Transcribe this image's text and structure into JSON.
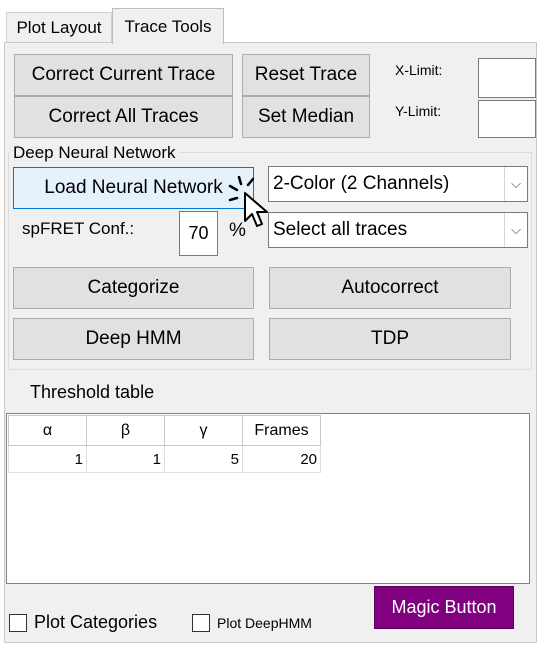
{
  "tabs": [
    {
      "label": "Plot Layout"
    },
    {
      "label": "Trace Tools"
    }
  ],
  "buttons": {
    "correct_current": "Correct Current Trace",
    "reset_trace": "Reset Trace",
    "correct_all": "Correct All Traces",
    "set_median": "Set Median",
    "load_nn": "Load Neural Network",
    "categorize": "Categorize",
    "autocorrect": "Autocorrect",
    "deep_hmm": "Deep HMM",
    "tdp": "TDP",
    "magic": "Magic Button"
  },
  "limits": {
    "x_label": "X-Limit:",
    "y_label": "Y-Limit:"
  },
  "dnn": {
    "group_title": "Deep Neural Network",
    "channel_select": "2-Color (2 Channels)",
    "conf_label": "spFRET Conf.:",
    "conf_value": "70",
    "conf_unit": "%",
    "trace_select": "Select all traces"
  },
  "threshold": {
    "title": "Threshold table",
    "columns": [
      "α",
      "β",
      "γ",
      "Frames"
    ],
    "rows": [
      [
        "1",
        "1",
        "5",
        "20"
      ]
    ]
  },
  "checkboxes": {
    "plot_categories": "Plot Categories",
    "plot_deephmm": "Plot DeepHMM"
  },
  "colors": {
    "magic_button": "#800080",
    "hover_border": "#0078d7"
  }
}
